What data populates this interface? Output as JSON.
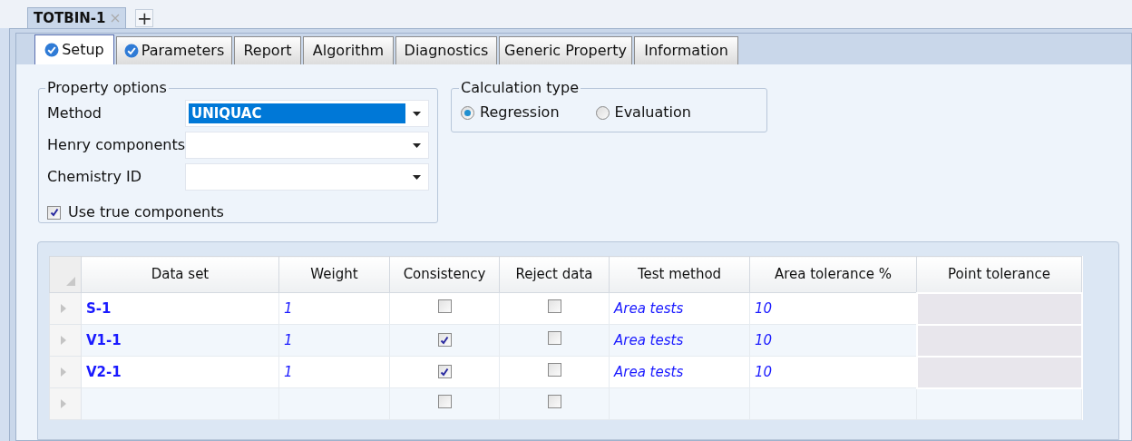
{
  "document_tabs": [
    {
      "label": "TOTBIN-1",
      "selected": true,
      "closable": true
    }
  ],
  "new_tab_button": "+",
  "tabs": [
    {
      "label": "Setup",
      "selected": true,
      "completed": true
    },
    {
      "label": "Parameters",
      "selected": false,
      "completed": true
    },
    {
      "label": "Report",
      "selected": false,
      "completed": false
    },
    {
      "label": "Algorithm",
      "selected": false,
      "completed": false
    },
    {
      "label": "Diagnostics",
      "selected": false,
      "completed": false
    },
    {
      "label": "Generic Property",
      "selected": false,
      "completed": false
    },
    {
      "label": "Information",
      "selected": false,
      "completed": false
    }
  ],
  "property_options": {
    "title": "Property options",
    "fields": [
      {
        "label": "Method",
        "value": "UNIQUAC",
        "highlighted": true
      },
      {
        "label": "Henry components",
        "highlighted": false
      },
      {
        "label": "Chemistry ID",
        "highlighted": false
      }
    ],
    "use_true_components": {
      "label": "Use true components",
      "checked": true
    }
  },
  "calculation_type": {
    "title": "Calculation type",
    "options": [
      {
        "label": "Regression",
        "selected": true
      },
      {
        "label": "Evaluation",
        "selected": false
      }
    ]
  },
  "table": {
    "columns": [
      "Data set",
      "Weight",
      "Consistency",
      "Reject data",
      "Test method",
      "Area tolerance %",
      "Point tolerance"
    ],
    "rows": [
      {
        "data_set": "S-1",
        "weight": "1",
        "consistency": false,
        "reject_data": false,
        "test_method": "Area tests",
        "area_tolerance": "10",
        "point_tolerance_disabled": true
      },
      {
        "data_set": "V1-1",
        "weight": "1",
        "consistency": true,
        "reject_data": false,
        "test_method": "Area tests",
        "area_tolerance": "10",
        "point_tolerance_disabled": true
      },
      {
        "data_set": "V2-1",
        "weight": "1",
        "consistency": true,
        "reject_data": false,
        "test_method": "Area tests",
        "area_tolerance": "10",
        "point_tolerance_disabled": true
      },
      {
        "consistency": false,
        "reject_data": false,
        "point_tolerance_disabled": false
      }
    ]
  }
}
